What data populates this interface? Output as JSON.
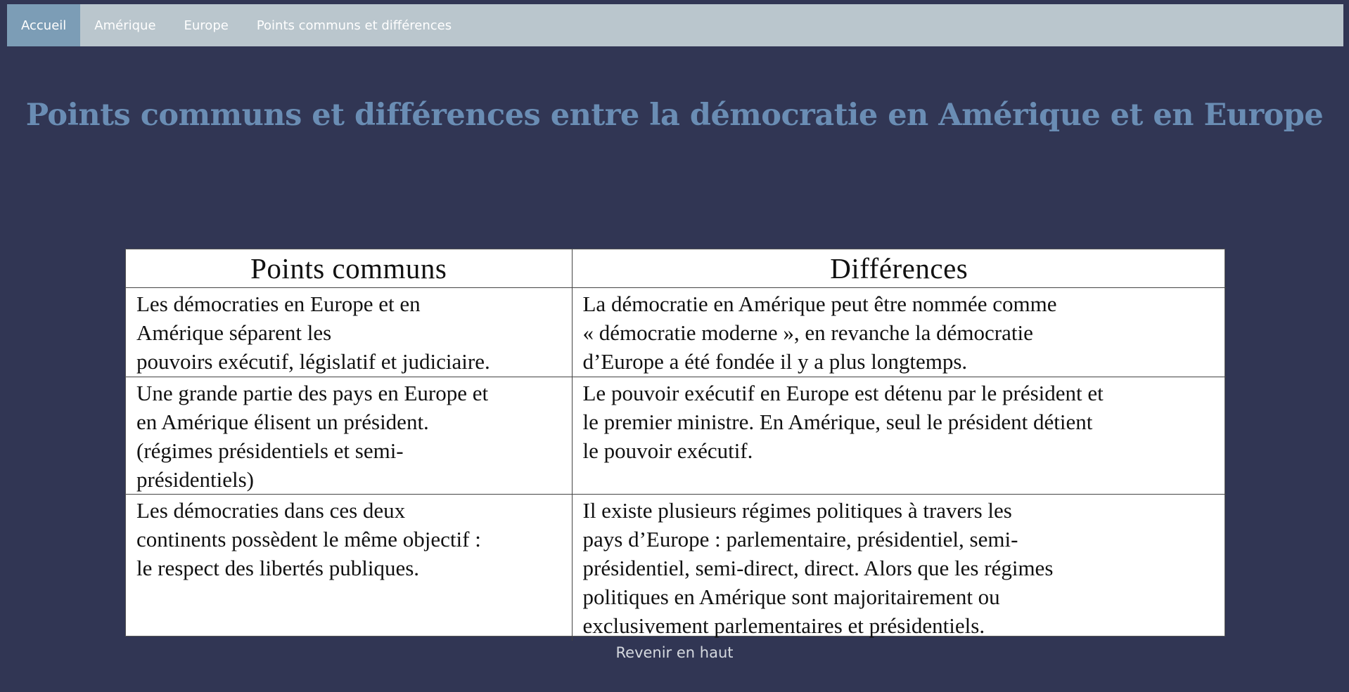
{
  "nav": {
    "items": [
      {
        "label": "Accueil",
        "active": true
      },
      {
        "label": "Amérique",
        "active": false
      },
      {
        "label": "Europe",
        "active": false
      },
      {
        "label": "Points communs et différences",
        "active": false
      }
    ]
  },
  "page": {
    "title": "Points communs et différences entre la démocratie en Amérique et en Europe"
  },
  "table": {
    "headers": [
      "Points communs",
      "Différences"
    ],
    "rows": [
      {
        "common": "Les démocraties en Europe et en\nAmérique séparent les\npouvoirs exécutif, législatif et judiciaire.",
        "difference": "La démocratie en Amérique peut être nommée comme\n« démocratie moderne », en revanche la démocratie\nd’Europe a été fondée il y a plus longtemps."
      },
      {
        "common": "Une grande partie des pays en Europe et\nen Amérique élisent un président.\n(régimes présidentiels et semi-\nprésidentiels)",
        "difference": "Le pouvoir exécutif en Europe est détenu par le président et\nle premier ministre. En Amérique, seul le président détient\nle pouvoir exécutif."
      },
      {
        "common": "Les démocraties dans ces deux\ncontinents possèdent le même objectif :\nle respect des libertés publiques.",
        "difference": "Il existe plusieurs régimes politiques à travers les\npays d’Europe : parlementaire, présidentiel, semi-\nprésidentiel, semi-direct, direct. Alors que les régimes\npolitiques en Amérique sont majoritairement ou\nexclusivement parlementaires et présidentiels."
      }
    ]
  },
  "footer": {
    "back_to_top": "Revenir en haut"
  },
  "colors": {
    "background": "#313654",
    "navbar": "#bac6cd",
    "nav_active": "#7c9db6",
    "title": "#6a8db4",
    "table_bg": "#ffffff"
  }
}
